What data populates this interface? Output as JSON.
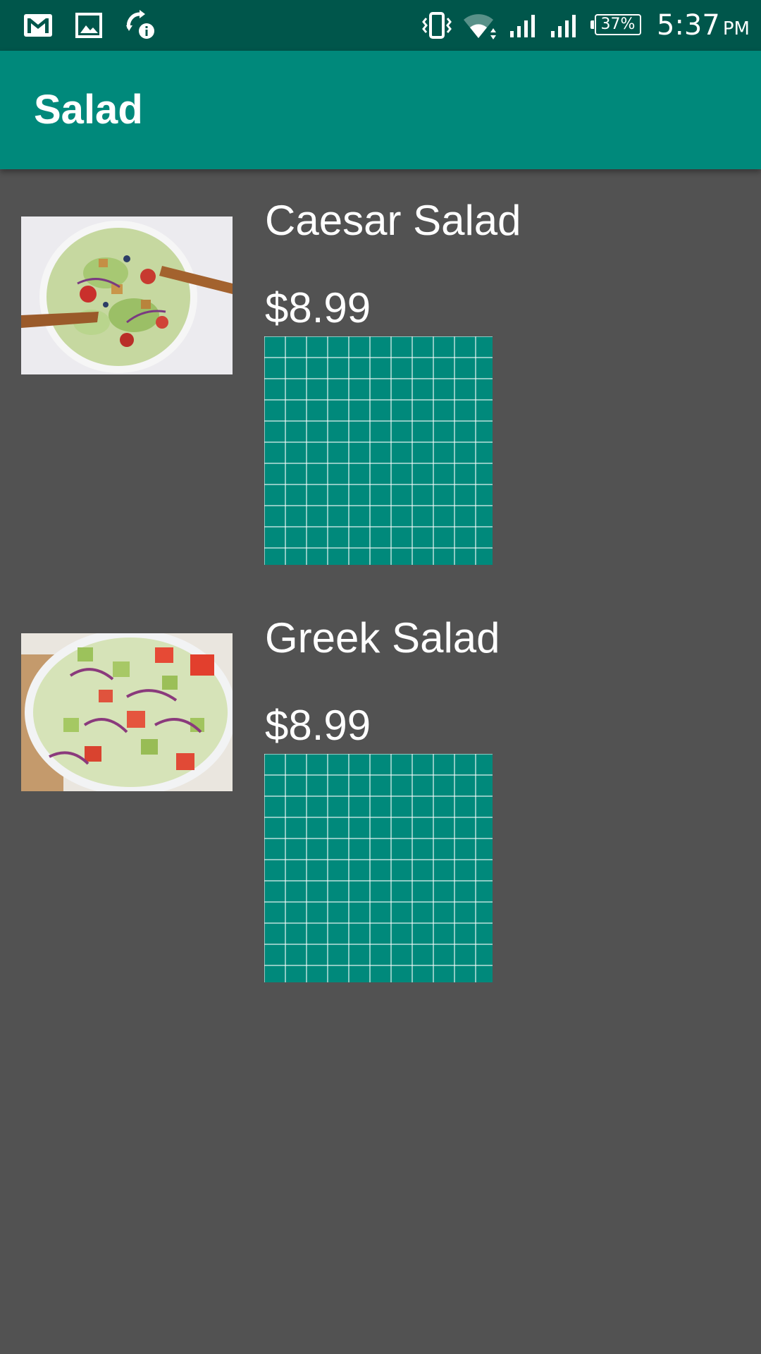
{
  "status_bar": {
    "icons": [
      "gmail-icon",
      "gallery-icon",
      "sync-info-icon",
      "vibrate-icon",
      "wifi-icon",
      "signal-icon",
      "signal-icon"
    ],
    "battery": "37%",
    "time": "5:37",
    "ampm": "PM"
  },
  "app_bar": {
    "title": "Salad"
  },
  "items": [
    {
      "name": "Caesar Salad",
      "price": "$8.99"
    },
    {
      "name": "Greek Salad",
      "price": "$8.99"
    }
  ],
  "colors": {
    "status_bar": "#00564b",
    "app_bar": "#00897b",
    "background": "#525252",
    "grid_box": "#00897b"
  }
}
